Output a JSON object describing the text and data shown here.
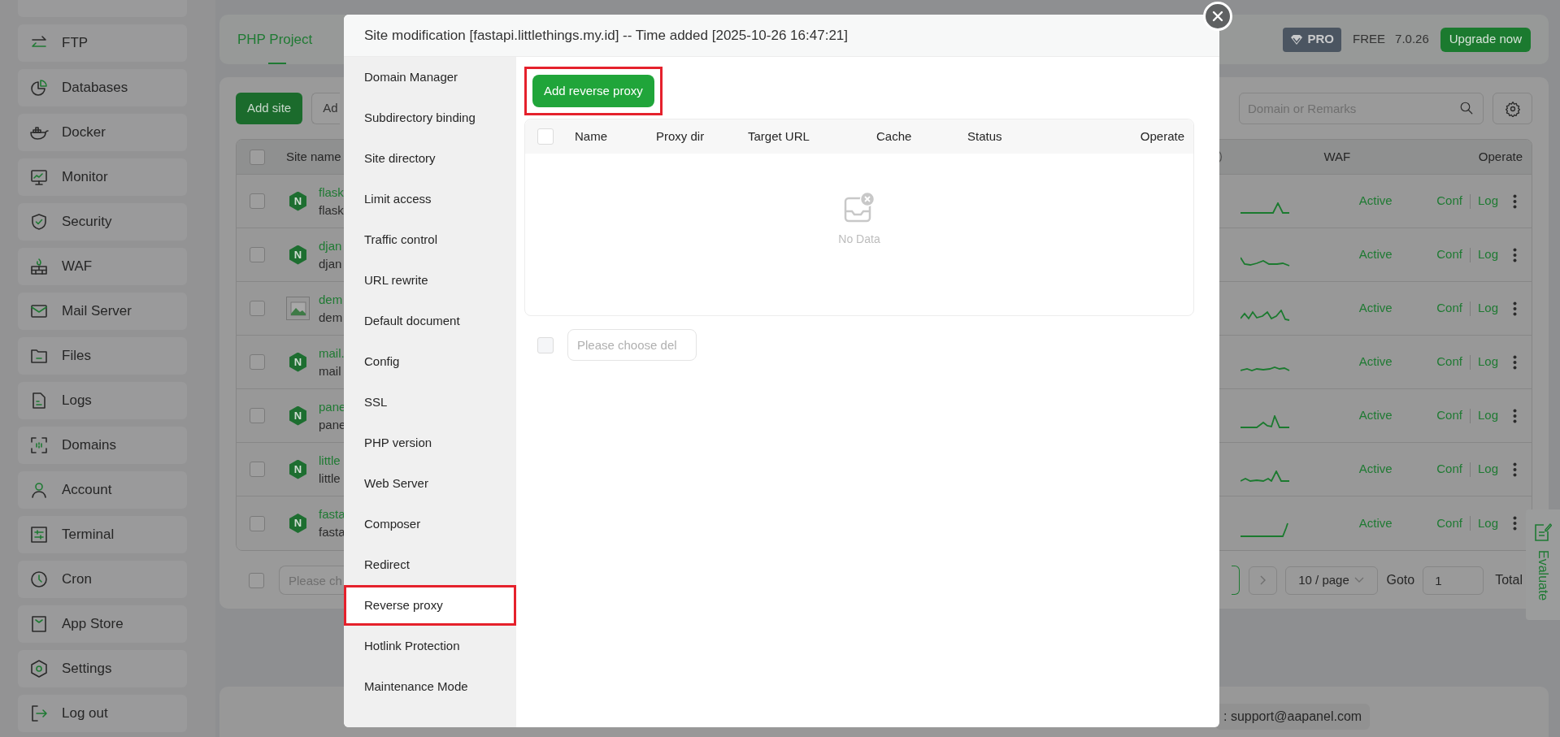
{
  "sidebar": {
    "items": [
      {
        "label": "FTP"
      },
      {
        "label": "Databases"
      },
      {
        "label": "Docker"
      },
      {
        "label": "Monitor"
      },
      {
        "label": "Security"
      },
      {
        "label": "WAF"
      },
      {
        "label": "Mail Server"
      },
      {
        "label": "Files"
      },
      {
        "label": "Logs"
      },
      {
        "label": "Domains"
      },
      {
        "label": "Account"
      },
      {
        "label": "Terminal"
      },
      {
        "label": "Cron"
      },
      {
        "label": "App Store"
      },
      {
        "label": "Settings"
      },
      {
        "label": "Log out"
      }
    ]
  },
  "tabs": [
    {
      "label": "PHP Project",
      "selected": true
    }
  ],
  "header": {
    "pro_badge": "PRO",
    "plan": "FREE",
    "version": "7.0.26",
    "upgrade_button": "Upgrade now"
  },
  "toolbar": {
    "buttons": [
      "Add site",
      "Ad"
    ],
    "search": {
      "placeholder": "Domain or Remarks"
    }
  },
  "sites_table": {
    "select_all": false,
    "columns": [
      "Site name",
      "WAF",
      "Operate"
    ],
    "rows": [
      {
        "checked": false,
        "kind": "nginx",
        "logo": "N",
        "name": "flask",
        "sub": "flask",
        "waf": "Active",
        "actions": [
          "Conf",
          "Log"
        ]
      },
      {
        "checked": false,
        "kind": "nginx",
        "logo": "N",
        "name": "djan",
        "sub": "djan",
        "waf": "Active",
        "actions": [
          "Conf",
          "Log"
        ]
      },
      {
        "checked": false,
        "kind": "image",
        "name": "dem",
        "sub": "dem",
        "waf": "Active",
        "actions": [
          "Conf",
          "Log"
        ]
      },
      {
        "checked": false,
        "kind": "nginx",
        "logo": "N",
        "name": "mail.",
        "sub": "mail",
        "waf": "Active",
        "actions": [
          "Conf",
          "Log"
        ]
      },
      {
        "checked": false,
        "kind": "nginx",
        "logo": "N",
        "name": "pane",
        "sub": "pane",
        "waf": "Active",
        "actions": [
          "Conf",
          "Log"
        ]
      },
      {
        "checked": false,
        "kind": "nginx",
        "logo": "N",
        "name": "little",
        "sub": "little",
        "waf": "Active",
        "actions": [
          "Conf",
          "Log"
        ]
      },
      {
        "checked": false,
        "kind": "nginx",
        "logo": "N",
        "name": "fasta",
        "sub": "fasta",
        "waf": "Active",
        "actions": [
          "Conf",
          "Log"
        ]
      }
    ]
  },
  "pagination": {
    "select_all": false,
    "batch_placeholder": "Please ch",
    "page_size": "10 / page",
    "goto_label": "Goto",
    "goto_value": "1",
    "total": "Total"
  },
  "evaluate": "Evaluate",
  "footer": {
    "support": ": support@aapanel.com"
  },
  "modal": {
    "title": "Site modification [fastapi.littlethings.my.id] -- Time added [2025-10-26 16:47:21]",
    "menu": [
      {
        "label": "Domain Manager",
        "selected": false
      },
      {
        "label": "Subdirectory binding",
        "selected": false
      },
      {
        "label": "Site directory",
        "selected": false
      },
      {
        "label": "Limit access",
        "selected": false
      },
      {
        "label": "Traffic control",
        "selected": false
      },
      {
        "label": "URL rewrite",
        "selected": false
      },
      {
        "label": "Default document",
        "selected": false
      },
      {
        "label": "Config",
        "selected": false
      },
      {
        "label": "SSL",
        "selected": false
      },
      {
        "label": "PHP version",
        "selected": false
      },
      {
        "label": "Web Server",
        "selected": false
      },
      {
        "label": "Composer",
        "selected": false
      },
      {
        "label": "Redirect",
        "selected": false
      },
      {
        "label": "Reverse proxy",
        "selected": true
      },
      {
        "label": "Hotlink Protection",
        "selected": false
      },
      {
        "label": "Maintenance Mode",
        "selected": false
      }
    ],
    "add_button": {
      "label": "Add reverse proxy",
      "highlighted": true
    },
    "select_all": false,
    "columns": [
      "Name",
      "Proxy dir",
      "Target URL",
      "Cache",
      "Status",
      "Operate"
    ],
    "batch_checked": false,
    "empty_text": "No Data",
    "batch_placeholder": "Please choose del"
  }
}
